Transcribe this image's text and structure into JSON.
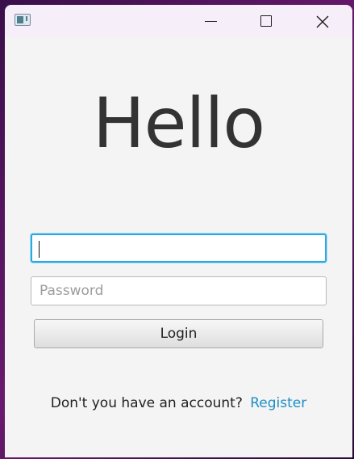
{
  "window": {
    "hello_text": "Hello"
  },
  "form": {
    "username_value": "",
    "password_placeholder": "Password",
    "login_label": "Login"
  },
  "footer": {
    "prompt": "Don't you have an account?",
    "register_label": "Register"
  },
  "icons": {
    "app": "app-icon",
    "minimize": "minimize-icon",
    "maximize": "maximize-icon",
    "close": "close-icon"
  },
  "colors": {
    "focus_accent": "#2aa9e0",
    "link": "#1f8fc4",
    "window_bg": "#f4f4f4",
    "titlebar_bg": "#f6eef8"
  }
}
